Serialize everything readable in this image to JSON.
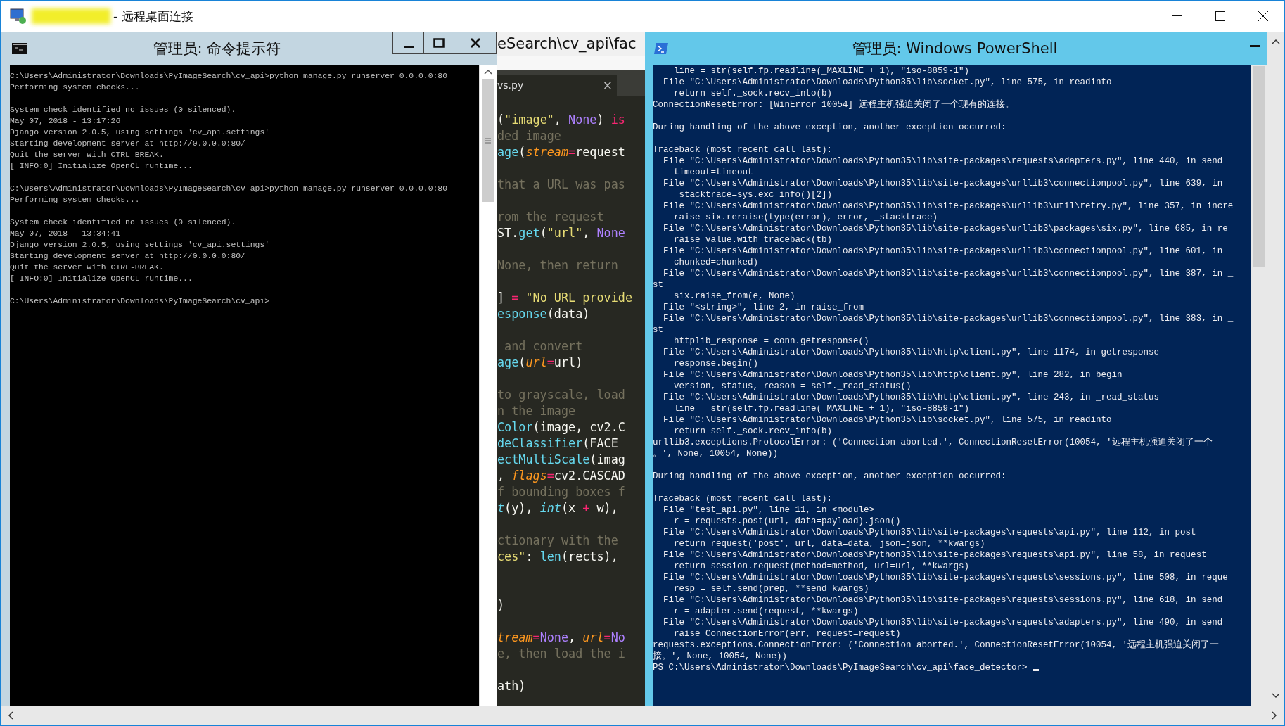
{
  "window": {
    "title": "- 远程桌面连接"
  },
  "cmd": {
    "title": "管理员: 命令提示符",
    "blocks": [
      [
        "C:\\Users\\Administrator\\Downloads\\PyImageSearch\\cv_api>python manage.py runserver 0.0.0.0:80",
        "Performing system checks..."
      ],
      [
        "System check identified no issues (0 silenced).",
        "May 07, 2018 - 13:17:26",
        "Django version 2.0.5, using settings 'cv_api.settings'",
        "Starting development server at http://0.0.0.0:80/",
        "Quit the server with CTRL-BREAK.",
        "[ INFO:0] Initialize OpenCL runtime..."
      ],
      [
        "C:\\Users\\Administrator\\Downloads\\PyImageSearch\\cv_api>python manage.py runserver 0.0.0.0:80",
        "Performing system checks..."
      ],
      [
        "System check identified no issues (0 silenced).",
        "May 07, 2018 - 13:34:41",
        "Django version 2.0.5, using settings 'cv_api.settings'",
        "Starting development server at http://0.0.0.0:80/",
        "Quit the server with CTRL-BREAK.",
        "[ INFO:0] Initialize OpenCL runtime..."
      ],
      [
        "C:\\Users\\Administrator\\Downloads\\PyImageSearch\\cv_api>"
      ]
    ]
  },
  "editor": {
    "path": "eSearch\\cv_api\\fac",
    "tab": {
      "label": "vs.py",
      "close": "×"
    },
    "lines": [
      {
        "kind": "code",
        "tokens": [
          {
            "kind": "plain",
            "text": "("
          },
          {
            "kind": "string",
            "text": "\"image\""
          },
          {
            "kind": "plain",
            "text": ", "
          },
          {
            "kind": "constant",
            "text": "None"
          },
          {
            "kind": "plain",
            "text": ") "
          },
          {
            "kind": "keyword",
            "text": "is"
          }
        ]
      },
      {
        "kind": "code",
        "tokens": [
          {
            "kind": "comment",
            "text": "ded image"
          }
        ]
      },
      {
        "kind": "code",
        "tokens": [
          {
            "kind": "function",
            "text": "age"
          },
          {
            "kind": "plain",
            "text": "("
          },
          {
            "kind": "param",
            "text": "stream"
          },
          {
            "kind": "operator",
            "text": "="
          },
          {
            "kind": "plain",
            "text": "request"
          }
        ]
      },
      {
        "kind": "blank"
      },
      {
        "kind": "code",
        "tokens": [
          {
            "kind": "comment",
            "text": "that a URL was pas"
          }
        ]
      },
      {
        "kind": "blank"
      },
      {
        "kind": "code",
        "tokens": [
          {
            "kind": "comment",
            "text": "rom the request"
          }
        ]
      },
      {
        "kind": "code",
        "tokens": [
          {
            "kind": "plain",
            "text": "ST."
          },
          {
            "kind": "function",
            "text": "get"
          },
          {
            "kind": "plain",
            "text": "("
          },
          {
            "kind": "string",
            "text": "\"url\""
          },
          {
            "kind": "plain",
            "text": ", "
          },
          {
            "kind": "constant",
            "text": "None"
          }
        ]
      },
      {
        "kind": "blank"
      },
      {
        "kind": "code",
        "tokens": [
          {
            "kind": "comment",
            "text": "None, then return"
          }
        ]
      },
      {
        "kind": "blank"
      },
      {
        "kind": "code",
        "tokens": [
          {
            "kind": "plain",
            "text": "] "
          },
          {
            "kind": "operator",
            "text": "="
          },
          {
            "kind": "string",
            "text": " \"No URL provide"
          }
        ]
      },
      {
        "kind": "code",
        "tokens": [
          {
            "kind": "function",
            "text": "esponse"
          },
          {
            "kind": "plain",
            "text": "(data)"
          }
        ]
      },
      {
        "kind": "blank"
      },
      {
        "kind": "code",
        "tokens": [
          {
            "kind": "comment",
            "text": " and convert"
          }
        ]
      },
      {
        "kind": "code",
        "tokens": [
          {
            "kind": "function",
            "text": "age"
          },
          {
            "kind": "plain",
            "text": "("
          },
          {
            "kind": "param",
            "text": "url"
          },
          {
            "kind": "operator",
            "text": "="
          },
          {
            "kind": "plain",
            "text": "url)"
          }
        ]
      },
      {
        "kind": "blank"
      },
      {
        "kind": "code",
        "tokens": [
          {
            "kind": "comment",
            "text": "to grayscale, load"
          }
        ]
      },
      {
        "kind": "code",
        "tokens": [
          {
            "kind": "comment",
            "text": "n the image"
          }
        ]
      },
      {
        "kind": "code",
        "tokens": [
          {
            "kind": "function",
            "text": "Color"
          },
          {
            "kind": "plain",
            "text": "(image, cv2.C"
          }
        ]
      },
      {
        "kind": "code",
        "tokens": [
          {
            "kind": "function",
            "text": "deClassifier"
          },
          {
            "kind": "plain",
            "text": "(FACE_"
          }
        ]
      },
      {
        "kind": "code",
        "tokens": [
          {
            "kind": "function",
            "text": "ectMultiScale"
          },
          {
            "kind": "plain",
            "text": "(imag"
          }
        ]
      },
      {
        "kind": "code",
        "tokens": [
          {
            "kind": "plain",
            "text": ", "
          },
          {
            "kind": "param",
            "text": "flags"
          },
          {
            "kind": "operator",
            "text": "="
          },
          {
            "kind": "plain",
            "text": "cv2.CASCAD"
          }
        ]
      },
      {
        "kind": "code",
        "tokens": [
          {
            "kind": "comment",
            "text": "f bounding boxes f"
          }
        ]
      },
      {
        "kind": "code",
        "tokens": [
          {
            "kind": "builtin",
            "text": "t"
          },
          {
            "kind": "plain",
            "text": "(y), "
          },
          {
            "kind": "builtin",
            "text": "int"
          },
          {
            "kind": "plain",
            "text": "(x "
          },
          {
            "kind": "operator",
            "text": "+"
          },
          {
            "kind": "plain",
            "text": " w),"
          }
        ]
      },
      {
        "kind": "blank"
      },
      {
        "kind": "code",
        "tokens": [
          {
            "kind": "comment",
            "text": "ctionary with the"
          }
        ]
      },
      {
        "kind": "code",
        "tokens": [
          {
            "kind": "string",
            "text": "ces\""
          },
          {
            "kind": "plain",
            "text": ": "
          },
          {
            "kind": "function",
            "text": "len"
          },
          {
            "kind": "plain",
            "text": "(rects),"
          }
        ]
      },
      {
        "kind": "blank"
      },
      {
        "kind": "blank"
      },
      {
        "kind": "code",
        "tokens": [
          {
            "kind": "plain",
            "text": ")"
          }
        ]
      },
      {
        "kind": "blank"
      },
      {
        "kind": "code",
        "tokens": [
          {
            "kind": "param",
            "text": "tream"
          },
          {
            "kind": "operator",
            "text": "="
          },
          {
            "kind": "constant",
            "text": "None"
          },
          {
            "kind": "plain",
            "text": ", "
          },
          {
            "kind": "param",
            "text": "url"
          },
          {
            "kind": "operator",
            "text": "="
          },
          {
            "kind": "constant",
            "text": "No"
          }
        ]
      },
      {
        "kind": "code",
        "tokens": [
          {
            "kind": "comment",
            "text": "e, then load the i"
          }
        ]
      },
      {
        "kind": "blank"
      },
      {
        "kind": "code",
        "tokens": [
          {
            "kind": "plain",
            "text": "ath)"
          }
        ]
      }
    ]
  },
  "powershell": {
    "title": "管理员: Windows PowerShell",
    "blocks": [
      [
        "    line = str(self.fp.readline(_MAXLINE + 1), \"iso-8859-1\")",
        "  File \"C:\\Users\\Administrator\\Downloads\\Python35\\lib\\socket.py\", line 575, in readinto",
        "    return self._sock.recv_into(b)",
        "ConnectionResetError: [WinError 10054] 远程主机强迫关闭了一个现有的连接。"
      ],
      [
        "During handling of the above exception, another exception occurred:"
      ],
      [
        "Traceback (most recent call last):",
        "  File \"C:\\Users\\Administrator\\Downloads\\Python35\\lib\\site-packages\\requests\\adapters.py\", line 440, in send",
        "    timeout=timeout",
        "  File \"C:\\Users\\Administrator\\Downloads\\Python35\\lib\\site-packages\\urllib3\\connectionpool.py\", line 639, in",
        "    _stacktrace=sys.exc_info()[2])",
        "  File \"C:\\Users\\Administrator\\Downloads\\Python35\\lib\\site-packages\\urllib3\\util\\retry.py\", line 357, in incre",
        "    raise six.reraise(type(error), error, _stacktrace)",
        "  File \"C:\\Users\\Administrator\\Downloads\\Python35\\lib\\site-packages\\urllib3\\packages\\six.py\", line 685, in re",
        "    raise value.with_traceback(tb)",
        "  File \"C:\\Users\\Administrator\\Downloads\\Python35\\lib\\site-packages\\urllib3\\connectionpool.py\", line 601, in",
        "    chunked=chunked)",
        "  File \"C:\\Users\\Administrator\\Downloads\\Python35\\lib\\site-packages\\urllib3\\connectionpool.py\", line 387, in _",
        "st",
        "    six.raise_from(e, None)",
        "  File \"<string>\", line 2, in raise_from",
        "  File \"C:\\Users\\Administrator\\Downloads\\Python35\\lib\\site-packages\\urllib3\\connectionpool.py\", line 383, in _",
        "st",
        "    httplib_response = conn.getresponse()",
        "  File \"C:\\Users\\Administrator\\Downloads\\Python35\\lib\\http\\client.py\", line 1174, in getresponse",
        "    response.begin()",
        "  File \"C:\\Users\\Administrator\\Downloads\\Python35\\lib\\http\\client.py\", line 282, in begin",
        "    version, status, reason = self._read_status()",
        "  File \"C:\\Users\\Administrator\\Downloads\\Python35\\lib\\http\\client.py\", line 243, in _read_status",
        "    line = str(self.fp.readline(_MAXLINE + 1), \"iso-8859-1\")",
        "  File \"C:\\Users\\Administrator\\Downloads\\Python35\\lib\\socket.py\", line 575, in readinto",
        "    return self._sock.recv_into(b)",
        "urllib3.exceptions.ProtocolError: ('Connection aborted.', ConnectionResetError(10054, '远程主机强迫关闭了一个",
        "。', None, 10054, None))"
      ],
      [
        "During handling of the above exception, another exception occurred:"
      ],
      [
        "Traceback (most recent call last):",
        "  File \"test_api.py\", line 11, in <module>",
        "    r = requests.post(url, data=payload).json()",
        "  File \"C:\\Users\\Administrator\\Downloads\\Python35\\lib\\site-packages\\requests\\api.py\", line 112, in post",
        "    return request('post', url, data=data, json=json, **kwargs)",
        "  File \"C:\\Users\\Administrator\\Downloads\\Python35\\lib\\site-packages\\requests\\api.py\", line 58, in request",
        "    return session.request(method=method, url=url, **kwargs)",
        "  File \"C:\\Users\\Administrator\\Downloads\\Python35\\lib\\site-packages\\requests\\sessions.py\", line 508, in reque",
        "    resp = self.send(prep, **send_kwargs)",
        "  File \"C:\\Users\\Administrator\\Downloads\\Python35\\lib\\site-packages\\requests\\sessions.py\", line 618, in send",
        "    r = adapter.send(request, **kwargs)",
        "  File \"C:\\Users\\Administrator\\Downloads\\Python35\\lib\\site-packages\\requests\\adapters.py\", line 490, in send",
        "    raise ConnectionError(err, request=request)",
        "requests.exceptions.ConnectionError: ('Connection aborted.', ConnectionResetError(10054, '远程主机强迫关闭了一",
        "接。', None, 10054, None))",
        "PS C:\\Users\\Administrator\\Downloads\\PyImageSearch\\cv_api\\face_detector>"
      ]
    ]
  }
}
